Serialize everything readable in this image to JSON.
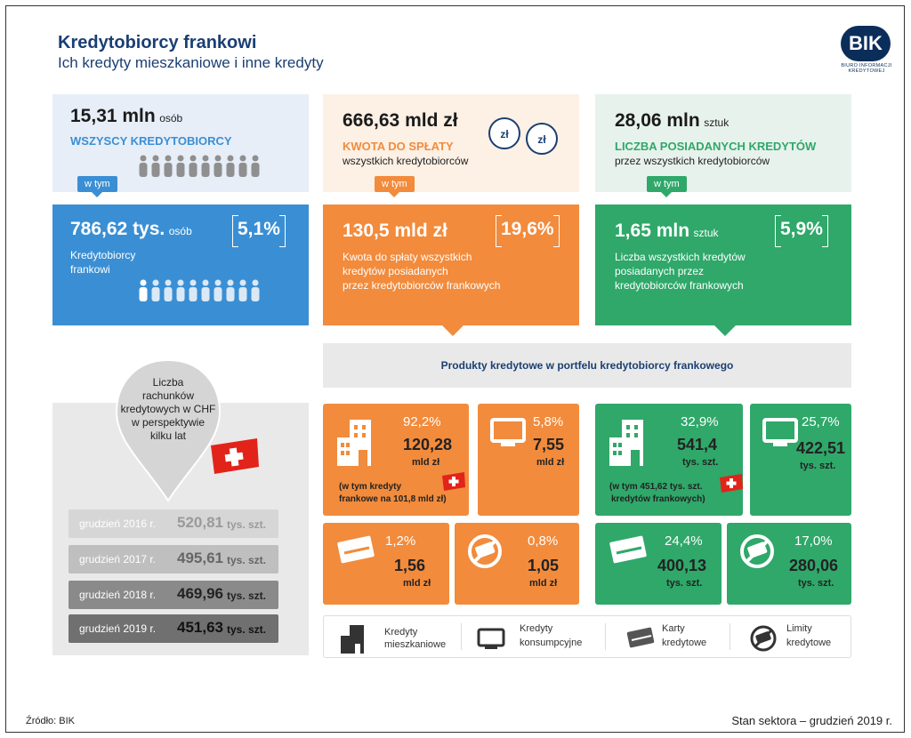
{
  "header": {
    "title": "Kredytobiorcy frankowi",
    "subtitle": "Ich kredyty mieszkaniowe i inne kredyty",
    "logo_text": "BIK",
    "logo_caption": "BIURO INFORMACJI KREDYTOWEJ"
  },
  "colors": {
    "blue": "#3a8fd4",
    "blue_light": "#e7eef8",
    "orange": "#f28b3c",
    "orange_light": "#fdf0e4",
    "green": "#2fa86a",
    "green_light": "#e8f2ec",
    "grey": "#e9e9e9",
    "navy": "#1a3f73"
  },
  "top": {
    "borrowers": {
      "value": "15,31 mln",
      "unit": "osób",
      "label": "WSZYSCY KREDYTOBIORCY"
    },
    "amount": {
      "value": "666,63 mld zł",
      "label": "KWOTA DO SPŁATY",
      "sub": "wszystkich kredytobiorców",
      "coin_text": "zł"
    },
    "credits": {
      "value": "28,06 mln",
      "unit": "sztuk",
      "label": "LICZBA POSIADANYCH KREDYTÓW",
      "sub": "przez wszystkich kredytobiorców"
    }
  },
  "tag_label": "w tym",
  "mid": {
    "borrowers": {
      "value": "786,62 tys.",
      "unit": "osób",
      "pct": "5,1%",
      "desc1": "Kredytobiorcy",
      "desc2": "frankowi"
    },
    "amount": {
      "value": "130,5 mld zł",
      "pct": "19,6%",
      "desc1": "Kwota do spłaty wszystkich",
      "desc2": "kredytów posiadanych",
      "desc3": "przez kredytobiorców frankowych"
    },
    "credits": {
      "value": "1,65 mln",
      "unit": "sztuk",
      "pct": "5,9%",
      "desc1": "Liczba wszystkich kredytów",
      "desc2": "posiadanych przez",
      "desc3": "kredytobiorców frankowych"
    }
  },
  "products_header": "Produkty kredytowe w portfelu kredytobiorcy frankowego",
  "products": {
    "amount": [
      {
        "pct": "92,2%",
        "value": "120,28",
        "unit": "mld zł",
        "note1": "(w tym kredyty",
        "note2": "frankowe na 101,8 mld zł)"
      },
      {
        "pct": "5,8%",
        "value": "7,55",
        "unit": "mld zł"
      },
      {
        "pct": "1,2%",
        "value": "1,56",
        "unit": "mld zł"
      },
      {
        "pct": "0,8%",
        "value": "1,05",
        "unit": "mld zł"
      }
    ],
    "count": [
      {
        "pct": "32,9%",
        "value": "541,4",
        "unit": "tys. szt.",
        "note1": "(w tym 451,62 tys. szt.",
        "note2": "kredytów frankowych)"
      },
      {
        "pct": "25,7%",
        "value": "422,51",
        "unit": "tys. szt."
      },
      {
        "pct": "24,4%",
        "value": "400,13",
        "unit": "tys. szt."
      },
      {
        "pct": "17,0%",
        "value": "280,06",
        "unit": "tys. szt."
      }
    ]
  },
  "accounts": {
    "bubble": [
      "Liczba",
      "rachunków",
      "kredytowych w CHF",
      "w perspektywie",
      "kilku lat"
    ],
    "rows": [
      {
        "label": "grudzień 2016 r.",
        "value": "520,81",
        "unit": "tys. szt."
      },
      {
        "label": "grudzień 2017 r.",
        "value": "495,61",
        "unit": "tys. szt."
      },
      {
        "label": "grudzień 2018 r.",
        "value": "469,96",
        "unit": "tys. szt."
      },
      {
        "label": "grudzień 2019 r.",
        "value": "451,63",
        "unit": "tys. szt."
      }
    ]
  },
  "legend": [
    {
      "icon": "building-icon",
      "l1": "Kredyty",
      "l2": "mieszkaniowe"
    },
    {
      "icon": "monitor-icon",
      "l1": "Kredyty",
      "l2": "konsumpcyjne"
    },
    {
      "icon": "card-icon",
      "l1": "Karty",
      "l2": "kredytowe"
    },
    {
      "icon": "limit-icon",
      "l1": "Limity",
      "l2": "kredytowe"
    }
  ],
  "footer": {
    "source": "Źródło: BIK",
    "status": "Stan sektora – grudzień 2019 r."
  }
}
